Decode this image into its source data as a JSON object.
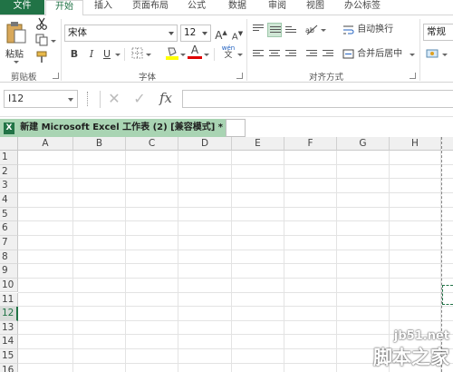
{
  "menu": {
    "tabs": [
      {
        "label": "文件"
      },
      {
        "label": "开始"
      },
      {
        "label": "插入"
      },
      {
        "label": "页面布局"
      },
      {
        "label": "公式"
      },
      {
        "label": "数据"
      },
      {
        "label": "审阅"
      },
      {
        "label": "视图"
      },
      {
        "label": "办公标签"
      }
    ],
    "active_tab": "开始"
  },
  "ribbon": {
    "clipboard": {
      "paste_label": "粘贴",
      "group_label": "剪贴板"
    },
    "font": {
      "font_name": "宋体",
      "font_size": "12",
      "grow_label": "A",
      "shrink_label": "A",
      "bold": "B",
      "italic": "I",
      "underline": "U",
      "font_color_label": "A",
      "phonetic_label": "wén",
      "group_label": "字体"
    },
    "alignment": {
      "wrap_label": "自动换行",
      "merge_label": "合并后居中",
      "group_label": "对齐方式"
    },
    "number": {
      "format_value": "常规"
    }
  },
  "formula_bar": {
    "name_box": "I12",
    "cancel_symbol": "✕",
    "enter_symbol": "✓",
    "fx_label": "fx",
    "formula_value": ""
  },
  "workbook_tab": {
    "title": "新建 Microsoft Excel 工作表 (2)  [兼容模式] *",
    "close_symbol": "×"
  },
  "grid": {
    "columns": [
      "A",
      "B",
      "C",
      "D",
      "E",
      "F",
      "G",
      "H"
    ],
    "rows": [
      "1",
      "2",
      "3",
      "4",
      "5",
      "6",
      "7",
      "8",
      "9",
      "10",
      "11",
      "12",
      "13",
      "14",
      "15",
      "16"
    ],
    "active_row": "12"
  },
  "watermark": {
    "line1": "jb51.net",
    "line2": "脚本之家"
  },
  "colors": {
    "accent": "#217346",
    "tab_fill": "#a9d4b3",
    "font_color": "#e00000",
    "fill_color": "#ffff00"
  }
}
